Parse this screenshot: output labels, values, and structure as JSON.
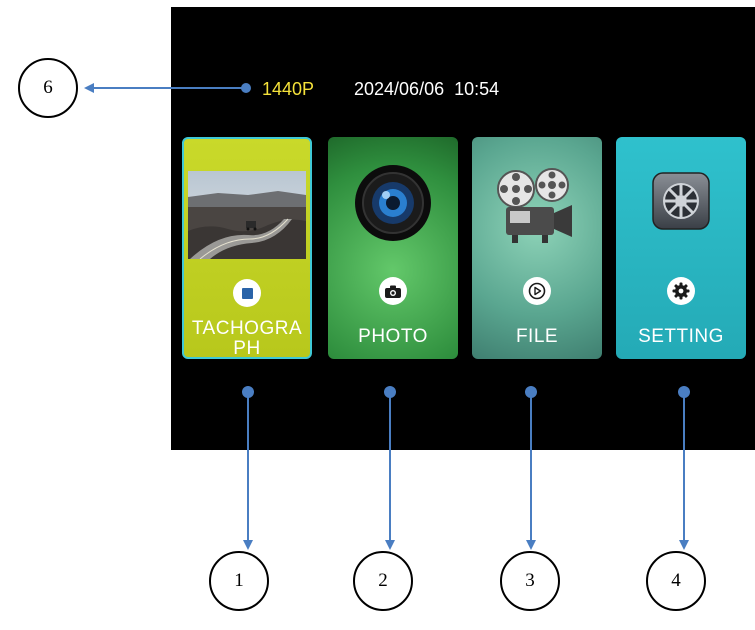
{
  "status": {
    "resolution": "1440P",
    "datetime": "2024/06/06  10:54"
  },
  "tiles": [
    {
      "label_line1": "TACHOGRA",
      "label_line2": "PH",
      "icon": "stop-icon",
      "color": "#c2d224"
    },
    {
      "label": "PHOTO",
      "icon": "camera-icon",
      "color": "#2f8f3e"
    },
    {
      "label": "FILE",
      "icon": "play-icon",
      "color": "#5aa690"
    },
    {
      "label": "SETTING",
      "icon": "gear-icon",
      "color": "#2ab7c4"
    }
  ],
  "callouts": {
    "c1": "1",
    "c2": "2",
    "c3": "3",
    "c4": "4",
    "c6": "6"
  },
  "colors": {
    "screen_bg": "#000000",
    "arrow": "#4a7ec2",
    "resolution_text": "#f4e13a",
    "selected_border": "#3fc9d6"
  }
}
